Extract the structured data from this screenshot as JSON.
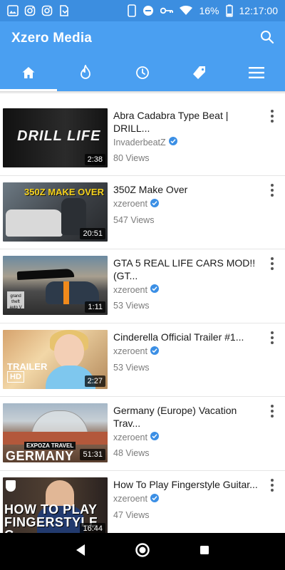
{
  "status_bar": {
    "battery": "16%",
    "time": "12:17:00",
    "icons": [
      "image-icon",
      "instagram-icon",
      "instagram-icon",
      "file-icon",
      "phone-icon",
      "dnd-icon",
      "key-icon",
      "wifi-icon",
      "battery-icon"
    ]
  },
  "app": {
    "title": "Xzero Media",
    "accent": "#4a9ff1"
  },
  "tabs": [
    {
      "icon": "home-icon",
      "active": true
    },
    {
      "icon": "fire-icon",
      "active": false
    },
    {
      "icon": "clock-icon",
      "active": false
    },
    {
      "icon": "tag-icon",
      "active": false
    },
    {
      "icon": "menu-icon",
      "active": false
    }
  ],
  "videos": [
    {
      "title": "Abra Cadabra Type Beat | DRILL...",
      "channel": "InvaderbeatZ",
      "views": "80 Views",
      "duration": "2:38",
      "thumb_text": "DRILL LIFE"
    },
    {
      "title": "350Z Make Over",
      "channel": "xzeroent",
      "views": "547 Views",
      "duration": "20:51",
      "thumb_text": "350Z MAKE OVER"
    },
    {
      "title": "GTA 5 REAL LIFE CARS MOD!! (GT...",
      "channel": "xzeroent",
      "views": "53 Views",
      "duration": "1:11",
      "thumb_text": "grand theft auto V"
    },
    {
      "title": "Cinderella Official Trailer #1...",
      "channel": "xzeroent",
      "views": "53 Views",
      "duration": "2:27",
      "thumb_text": "TRAILER",
      "thumb_text2": "HD"
    },
    {
      "title": "Germany (Europe) Vacation Trav...",
      "channel": "xzeroent",
      "views": "48 Views",
      "duration": "51:31",
      "thumb_text": "EXPOZA TRAVEL",
      "thumb_text2": "GERMANY"
    },
    {
      "title": "How To Play Fingerstyle Guitar...",
      "channel": "xzeroent",
      "views": "47 Views",
      "duration": "16:44",
      "thumb_text": "HOW TO PLAY FINGERSTYLE G"
    }
  ],
  "nav": [
    "back-icon",
    "home-circle-icon",
    "recents-icon"
  ]
}
